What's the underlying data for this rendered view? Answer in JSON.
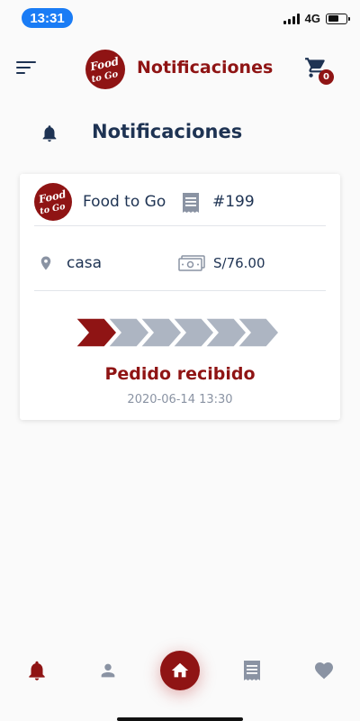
{
  "status_bar": {
    "time": "13:31",
    "network": "4G",
    "icons": [
      "signal-icon",
      "battery-icon"
    ]
  },
  "header": {
    "title": "Notificaciones",
    "cart_count": "0",
    "icons": [
      "menu-icon",
      "cart-icon"
    ],
    "logo_text": [
      "Food",
      "to Go"
    ]
  },
  "section": {
    "title": "Notificaciones",
    "icon": "bell-icon"
  },
  "notification": {
    "store_name": "Food to Go",
    "order_id": "#199",
    "address": "casa",
    "total": "S/76.00",
    "progress": {
      "steps_total": 6,
      "steps_completed": 1
    },
    "status": "Pedido recibido",
    "date": "2020-06-14 13:30",
    "icons": [
      "receipt-icon",
      "location-pin-icon",
      "money-icon"
    ]
  },
  "bottom_nav": {
    "items": [
      {
        "name": "notifications",
        "icon": "bell-icon",
        "active": true
      },
      {
        "name": "profile",
        "icon": "person-icon",
        "active": false
      },
      {
        "name": "home",
        "icon": "home-icon",
        "active": false
      },
      {
        "name": "orders",
        "icon": "receipt-icon",
        "active": false
      },
      {
        "name": "favorites",
        "icon": "heart-icon",
        "active": false
      }
    ]
  },
  "colors": {
    "brand": "#8f1414",
    "text_dark": "#1e3353",
    "inactive": "#8a93a3",
    "chevron_inactive": "#adb5c2",
    "status_pill": "#1a7cf5"
  }
}
